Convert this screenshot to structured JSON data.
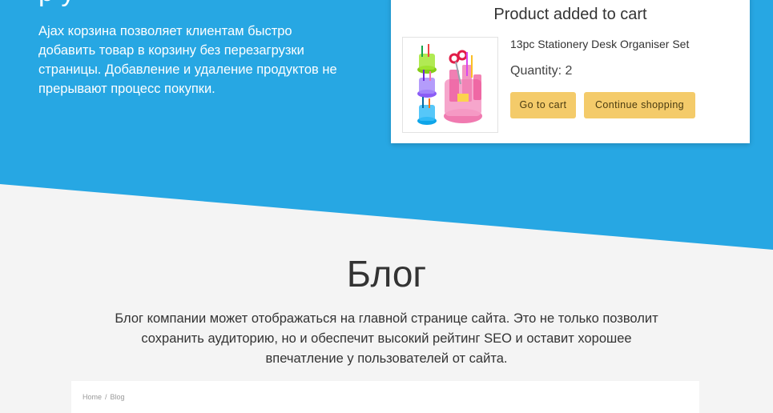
{
  "colors": {
    "hero_blue": "#27a7e3",
    "background": "#f4f4f4",
    "button": "#f4cb6a"
  },
  "hero": {
    "title_fragment": "р у",
    "description": "Ajax корзина позволяет клиентам быстро добавить товар в корзину без перезагрузки страницы. Добавление и удаление продуктов не прерывают процесс покупки."
  },
  "cart_popup": {
    "title": "Product added to cart",
    "product_name": "13pc Stationery Desk Organiser Set",
    "quantity_text": "Quantity: 2",
    "go_to_cart_label": "Go to cart",
    "continue_label": "Continue shopping",
    "thumbnail_icon": "desk-organiser-image"
  },
  "blog": {
    "title": "Блог",
    "description": "Блог компании может отображаться на главной странице сайта. Это не только позволит сохранить аудиторию, но и обеспечит высокий рейтинг SEO и оставит хорошее впечатление у пользователей от сайта."
  },
  "breadcrumb": {
    "home": "Home",
    "separator": "/",
    "current": "Blog"
  }
}
